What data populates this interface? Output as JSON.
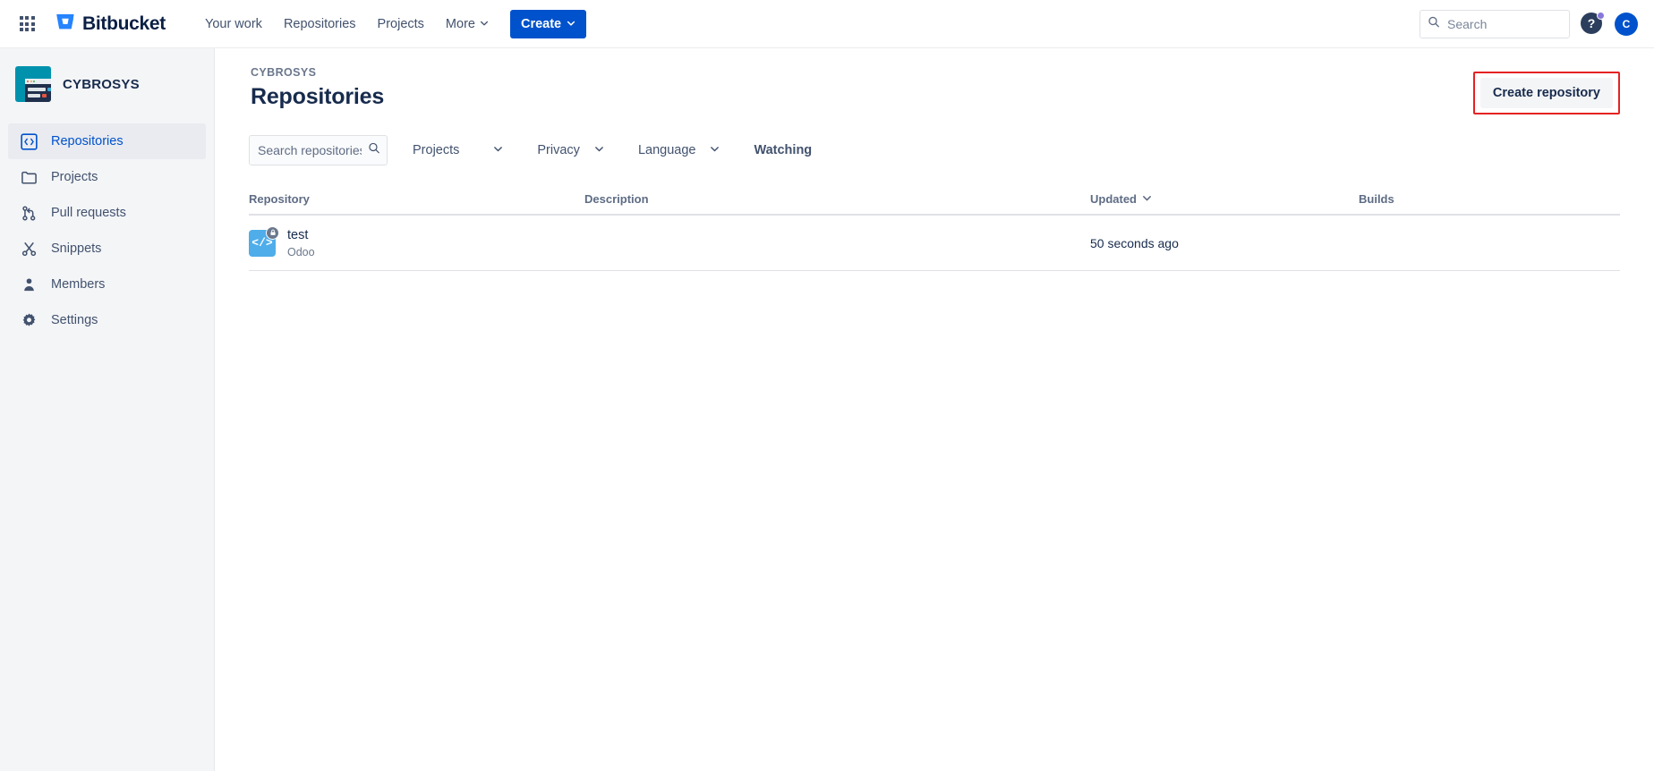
{
  "topnav": {
    "app_switcher_icon": "grid-icon",
    "brand_icon": "bitbucket-logo-icon",
    "brand": "Bitbucket",
    "links": [
      {
        "label": "Your work",
        "has_chevron": false
      },
      {
        "label": "Repositories",
        "has_chevron": false
      },
      {
        "label": "Projects",
        "has_chevron": false
      },
      {
        "label": "More",
        "has_chevron": true
      }
    ],
    "create_label": "Create",
    "search_placeholder": "Search",
    "search_value": "",
    "search_icon": "search-icon",
    "help_icon": "question-mark-icon",
    "help_badge": true,
    "avatar_initial": "C"
  },
  "sidebar": {
    "workspace_name": "CYBROSYS",
    "workspace_logo_icon": "cybrosys-logo-icon",
    "items": [
      {
        "label": "Repositories",
        "icon": "code-brackets-icon",
        "active": true
      },
      {
        "label": "Projects",
        "icon": "folder-icon",
        "active": false
      },
      {
        "label": "Pull requests",
        "icon": "pull-request-icon",
        "active": false
      },
      {
        "label": "Snippets",
        "icon": "scissors-icon",
        "active": false
      },
      {
        "label": "Members",
        "icon": "person-icon",
        "active": false
      },
      {
        "label": "Settings",
        "icon": "gear-icon",
        "active": false
      }
    ]
  },
  "page": {
    "breadcrumb": "CYBROSYS",
    "title": "Repositories",
    "create_repository_label": "Create repository",
    "highlight_color": "#e52222"
  },
  "filters": {
    "search_placeholder": "Search repositories",
    "search_value": "",
    "search_icon": "search-icon",
    "projects_label": "Projects",
    "privacy_label": "Privacy",
    "language_label": "Language",
    "watching_label": "Watching",
    "chevron_icon": "chevron-down-icon"
  },
  "table": {
    "columns": {
      "repository": "Repository",
      "description": "Description",
      "updated": "Updated",
      "builds": "Builds"
    },
    "sort_icon": "chevron-down-icon",
    "rows": [
      {
        "name": "test",
        "project": "Odoo",
        "description": "",
        "updated": "50 seconds ago",
        "builds": "",
        "icon": "code-repo-icon",
        "private": true,
        "lock_icon": "lock-icon",
        "icon_color": "#4fadea"
      }
    ]
  }
}
